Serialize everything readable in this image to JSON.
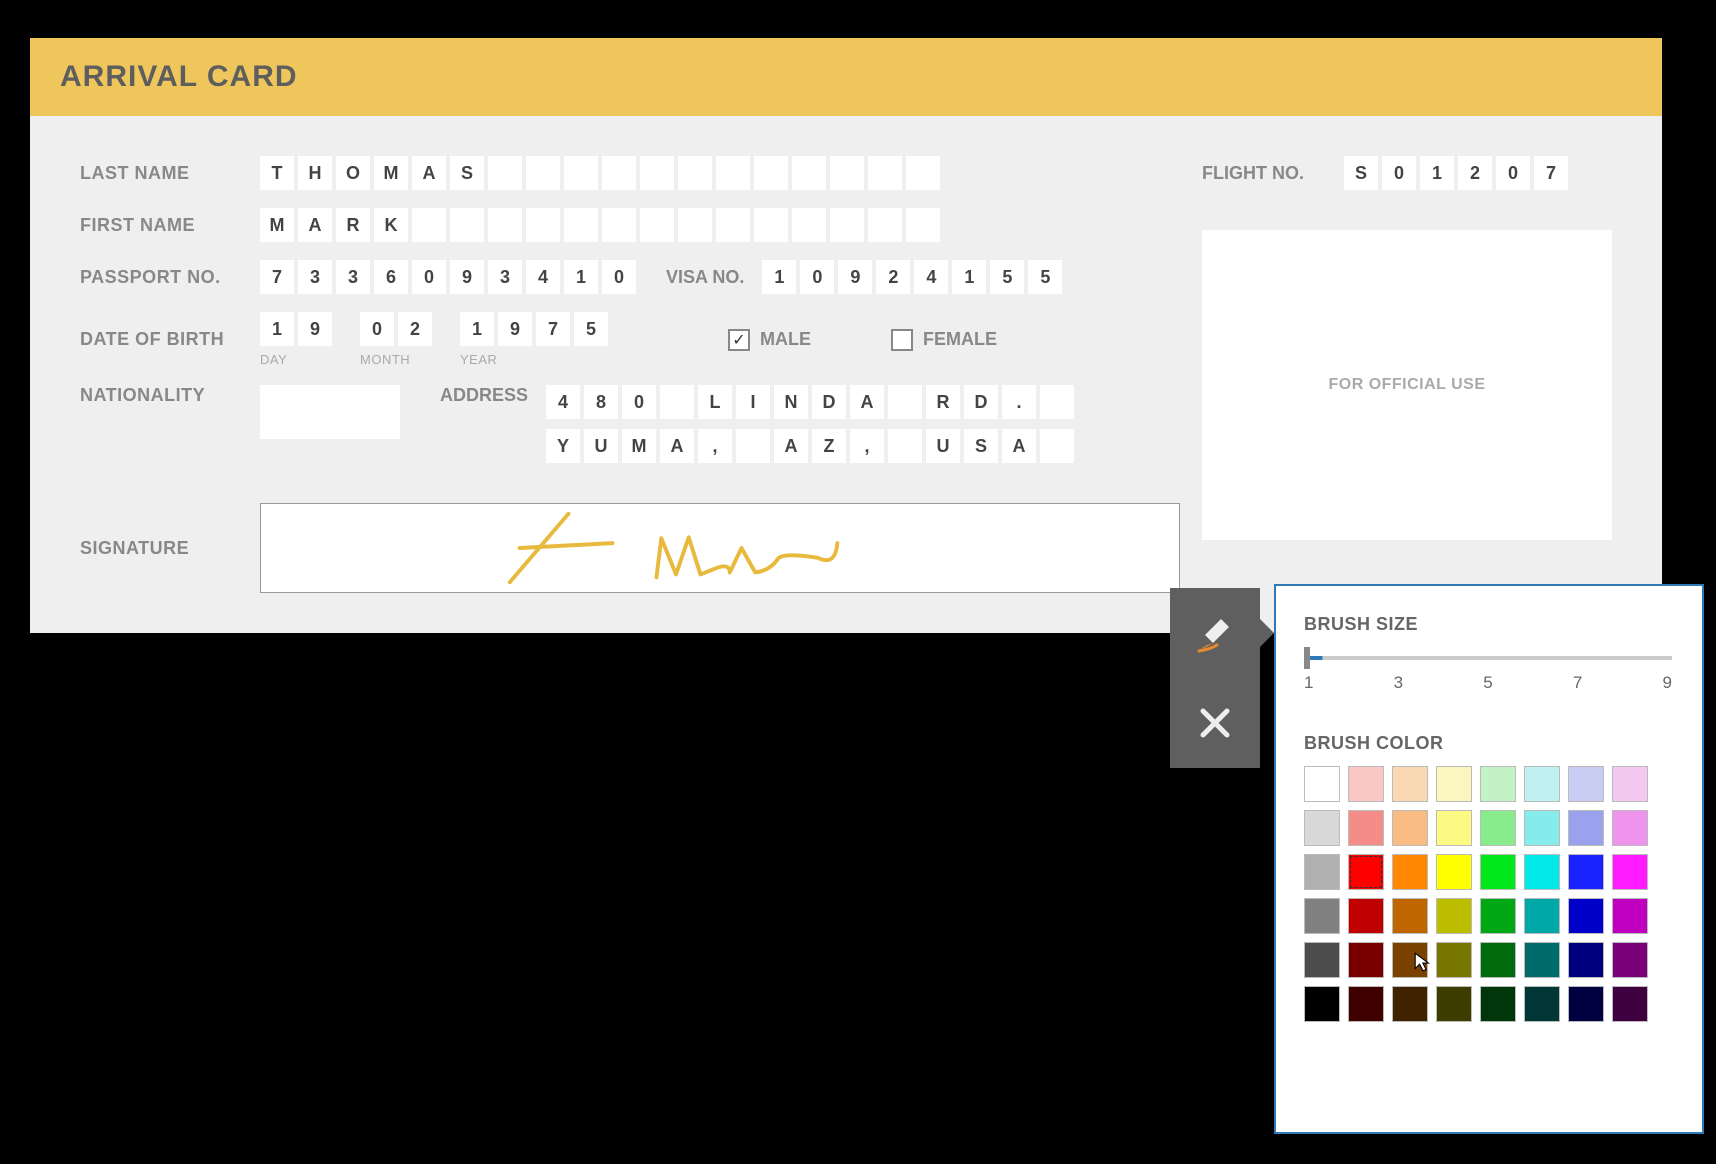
{
  "header": {
    "title": "ARRIVAL CARD"
  },
  "labels": {
    "last_name": "LAST NAME",
    "first_name": "FIRST NAME",
    "passport_no": "PASSPORT NO.",
    "visa_no": "VISA NO.",
    "dob": "DATE OF BIRTH",
    "day": "DAY",
    "month": "MONTH",
    "year": "YEAR",
    "male": "MALE",
    "female": "FEMALE",
    "nationality": "NATIONALITY",
    "address": "ADDRESS",
    "signature": "SIGNATURE",
    "flight_no": "FLIGHT NO.",
    "official_use": "FOR OFFICIAL USE"
  },
  "values": {
    "last_name": [
      "T",
      "H",
      "O",
      "M",
      "A",
      "S",
      "",
      "",
      "",
      "",
      "",
      "",
      "",
      "",
      "",
      "",
      "",
      ""
    ],
    "first_name": [
      "M",
      "A",
      "R",
      "K",
      "",
      "",
      "",
      "",
      "",
      "",
      "",
      "",
      "",
      "",
      "",
      "",
      "",
      ""
    ],
    "passport_no": [
      "7",
      "3",
      "3",
      "6",
      "0",
      "9",
      "3",
      "4",
      "1",
      "0"
    ],
    "visa_no": [
      "1",
      "0",
      "9",
      "2",
      "4",
      "1",
      "5",
      "5"
    ],
    "dob_day": [
      "1",
      "9"
    ],
    "dob_month": [
      "0",
      "2"
    ],
    "dob_year": [
      "1",
      "9",
      "7",
      "5"
    ],
    "male_checked": true,
    "female_checked": false,
    "address_line1": [
      "4",
      "8",
      "0",
      "",
      "L",
      "I",
      "N",
      "D",
      "A",
      "",
      "R",
      "D",
      ".",
      " "
    ],
    "address_line2": [
      "Y",
      "U",
      "M",
      "A",
      ",",
      "",
      "A",
      "Z",
      ",",
      "",
      "U",
      "S",
      "A",
      ""
    ],
    "flight_no": [
      "S",
      "0",
      "1",
      "2",
      "0",
      "7"
    ]
  },
  "brush": {
    "size_label": "BRUSH SIZE",
    "color_label": "BRUSH COLOR",
    "ticks": [
      "1",
      "3",
      "5",
      "7",
      "9"
    ],
    "size_value": "1",
    "colors": [
      "#ffffff",
      "#f9c8c5",
      "#f9d8b3",
      "#fbf5c0",
      "#c3f2c7",
      "#c0f1f0",
      "#c9cdf4",
      "#f3c9f1",
      "#d8d8d8",
      "#f48c87",
      "#f9bd84",
      "#fdfa83",
      "#88ec8d",
      "#85eceb",
      "#9aa2ef",
      "#ef94ed",
      "#b0b0b0",
      "#ff0000",
      "#ff8800",
      "#ffff00",
      "#00e81b",
      "#00e8e8",
      "#1a22ff",
      "#ff1aff",
      "#808080",
      "#c00000",
      "#c06600",
      "#bdbd00",
      "#00a813",
      "#00a8a8",
      "#0000c9",
      "#c000c0",
      "#4c4c4c",
      "#7a0000",
      "#7a4200",
      "#777700",
      "#006b0d",
      "#006b6b",
      "#00007f",
      "#7a007a",
      "#000000",
      "#3f0000",
      "#3f2200",
      "#3d3d00",
      "#00360a",
      "#003636",
      "#000040",
      "#3f003f"
    ],
    "selected_index": 17
  }
}
